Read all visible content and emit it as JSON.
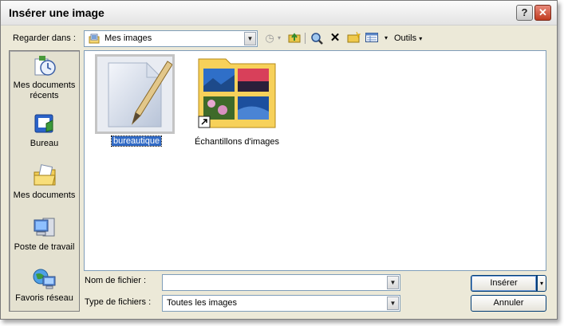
{
  "dialog": {
    "title": "Insérer une image",
    "help_label": "?",
    "close_label": "✕"
  },
  "toolbar": {
    "look_in_label": "Regarder dans :",
    "look_in_value": "Mes images",
    "tools_label": "Outils",
    "icons": [
      "back-icon",
      "up-folder-icon",
      "search-web-icon",
      "delete-icon",
      "new-folder-icon",
      "views-icon"
    ]
  },
  "places": [
    {
      "label": "Mes documents récents",
      "icon": "recent-documents-icon"
    },
    {
      "label": "Bureau",
      "icon": "desktop-icon"
    },
    {
      "label": "Mes documents",
      "icon": "my-documents-icon"
    },
    {
      "label": "Poste de travail",
      "icon": "my-computer-icon"
    },
    {
      "label": "Favoris réseau",
      "icon": "network-places-icon"
    }
  ],
  "files": [
    {
      "name": "bureautique",
      "selected": true,
      "icon": "document-pencil-icon"
    },
    {
      "name": "Échantillons d'images",
      "selected": false,
      "icon": "picture-folder-icon"
    }
  ],
  "form": {
    "filename_label": "Nom de fichier :",
    "filename_value": "",
    "filetype_label": "Type de fichiers :",
    "filetype_value": "Toutes les images"
  },
  "buttons": {
    "insert": "Insérer",
    "cancel": "Annuler"
  },
  "colors": {
    "dialog_bg": "#ece9d8",
    "selection": "#316ac5",
    "close_red": "#c03a1f"
  }
}
